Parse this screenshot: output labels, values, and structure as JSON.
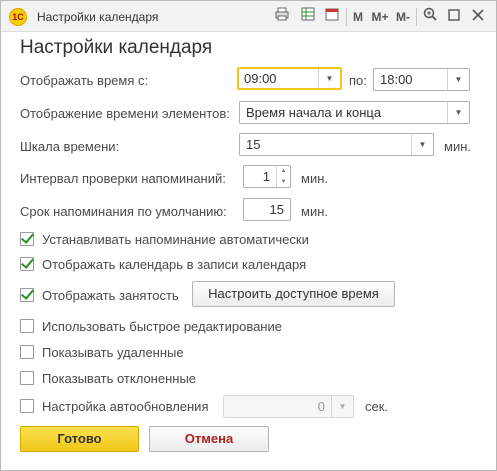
{
  "window": {
    "logo_text": "1С",
    "title": "Настройки календаря",
    "toolbar": {
      "m_label": "M",
      "mplus_label": "M+",
      "mminus_label": "M-"
    }
  },
  "form": {
    "heading": "Настройки календаря",
    "show_time_from": {
      "label": "Отображать время с:",
      "value": "09:00",
      "to_label": "по:",
      "to_value": "18:00"
    },
    "item_time_display": {
      "label": "Отображение времени элементов:",
      "value": "Время начала и конца"
    },
    "time_scale": {
      "label": "Шкала времени:",
      "value": "15",
      "unit": "мин."
    },
    "check_interval": {
      "label": "Интервал проверки напоминаний:",
      "value": "1",
      "unit": "мин."
    },
    "default_reminder": {
      "label": "Срок напоминания по умолчанию:",
      "value": "15",
      "unit": "мин."
    },
    "checkboxes": [
      {
        "label": "Устанавливать напоминание автоматически",
        "checked": true
      },
      {
        "label": "Отображать календарь в записи календаря",
        "checked": true
      },
      {
        "label": "Отображать занятость",
        "checked": true
      },
      {
        "label": "Использовать быстрое редактирование",
        "checked": false
      },
      {
        "label": "Показывать удаленные",
        "checked": false
      },
      {
        "label": "Показывать отклоненные",
        "checked": false
      },
      {
        "label": "Настройка автообновления",
        "checked": false
      }
    ],
    "configure_available_time_label": "Настроить доступное время",
    "autorefresh": {
      "value": "0",
      "unit": "сек."
    }
  },
  "buttons": {
    "ok_label": "Готово",
    "cancel_label": "Отмена"
  },
  "colors": {
    "primary_button": "#f1c71b",
    "focus_border": "#f1c71b",
    "check_mark": "#2c8f2c",
    "cancel_text": "#b02020"
  }
}
